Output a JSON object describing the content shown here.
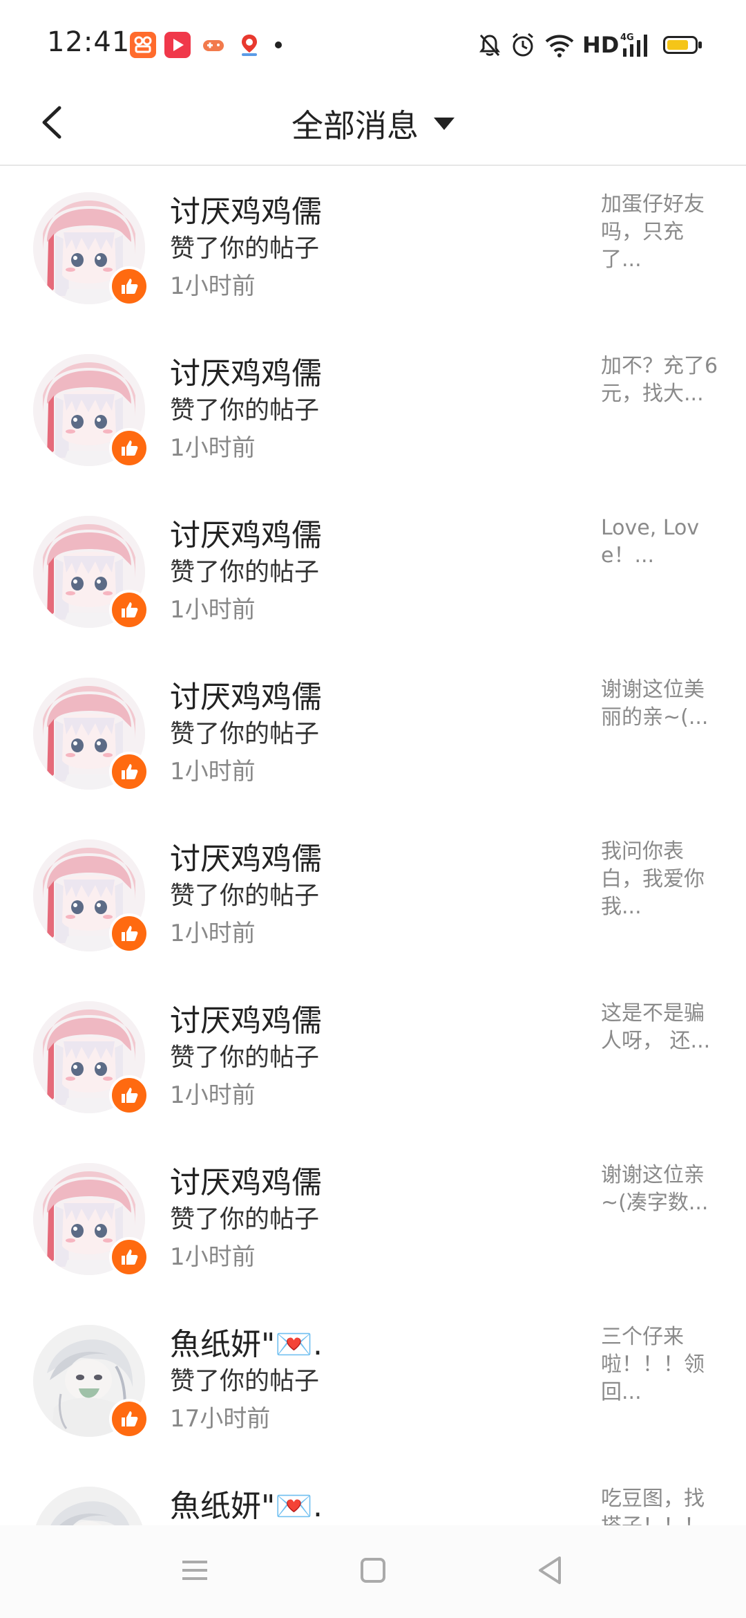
{
  "status": {
    "time": "12:41",
    "network_label": "HD",
    "signal_label": "4G",
    "icons": [
      "app-orange-icon",
      "video-app-icon",
      "game-icon",
      "map-pin-icon",
      "dot-icon",
      "bell-off-icon",
      "alarm-icon",
      "wifi-icon",
      "signal-icon",
      "battery-icon"
    ]
  },
  "header": {
    "title": "全部消息",
    "back_icon": "chevron-left-icon",
    "dropdown_icon": "caret-down-icon"
  },
  "messages": [
    {
      "name": "讨厌鸡鸡儒",
      "action": "赞了你的帖子",
      "time": "1小时前",
      "preview": "加蛋仔好友吗，只充了...",
      "avatar": "pink-hood-anime-girl"
    },
    {
      "name": "讨厌鸡鸡儒",
      "action": "赞了你的帖子",
      "time": "1小时前",
      "preview": "加不？充了6元，找大...",
      "avatar": "pink-hood-anime-girl"
    },
    {
      "name": "讨厌鸡鸡儒",
      "action": "赞了你的帖子",
      "time": "1小时前",
      "preview": "Love, Love！...",
      "avatar": "pink-hood-anime-girl"
    },
    {
      "name": "讨厌鸡鸡儒",
      "action": "赞了你的帖子",
      "time": "1小时前",
      "preview": "谢谢这位美丽的亲~(...",
      "avatar": "pink-hood-anime-girl"
    },
    {
      "name": "讨厌鸡鸡儒",
      "action": "赞了你的帖子",
      "time": "1小时前",
      "preview": "我问你表白，我爱你我...",
      "avatar": "pink-hood-anime-girl"
    },
    {
      "name": "讨厌鸡鸡儒",
      "action": "赞了你的帖子",
      "time": "1小时前",
      "preview": "这是不是骗人呀， 还...",
      "avatar": "pink-hood-anime-girl"
    },
    {
      "name": "讨厌鸡鸡儒",
      "action": "赞了你的帖子",
      "time": "1小时前",
      "preview": "谢谢这位亲~(凑字数...",
      "avatar": "pink-hood-anime-girl"
    },
    {
      "name": "魚纸妍\"💌.",
      "action": "赞了你的帖子",
      "time": "17小时前",
      "preview": "三个仔来啦！！！领回...",
      "avatar": "white-hair-sketch"
    },
    {
      "name": "魚纸妍\"💌.",
      "action": "",
      "time": "",
      "preview": "吃豆图，找搭子！！！",
      "avatar": "white-hair-sketch"
    }
  ],
  "navbar": {
    "icons": [
      "menu-icon",
      "home-square-icon",
      "back-triangle-icon"
    ]
  },
  "colors": {
    "accent": "#ff6a10",
    "text_primary": "#222222",
    "text_secondary": "#888888",
    "divider": "#e6e6e6"
  }
}
